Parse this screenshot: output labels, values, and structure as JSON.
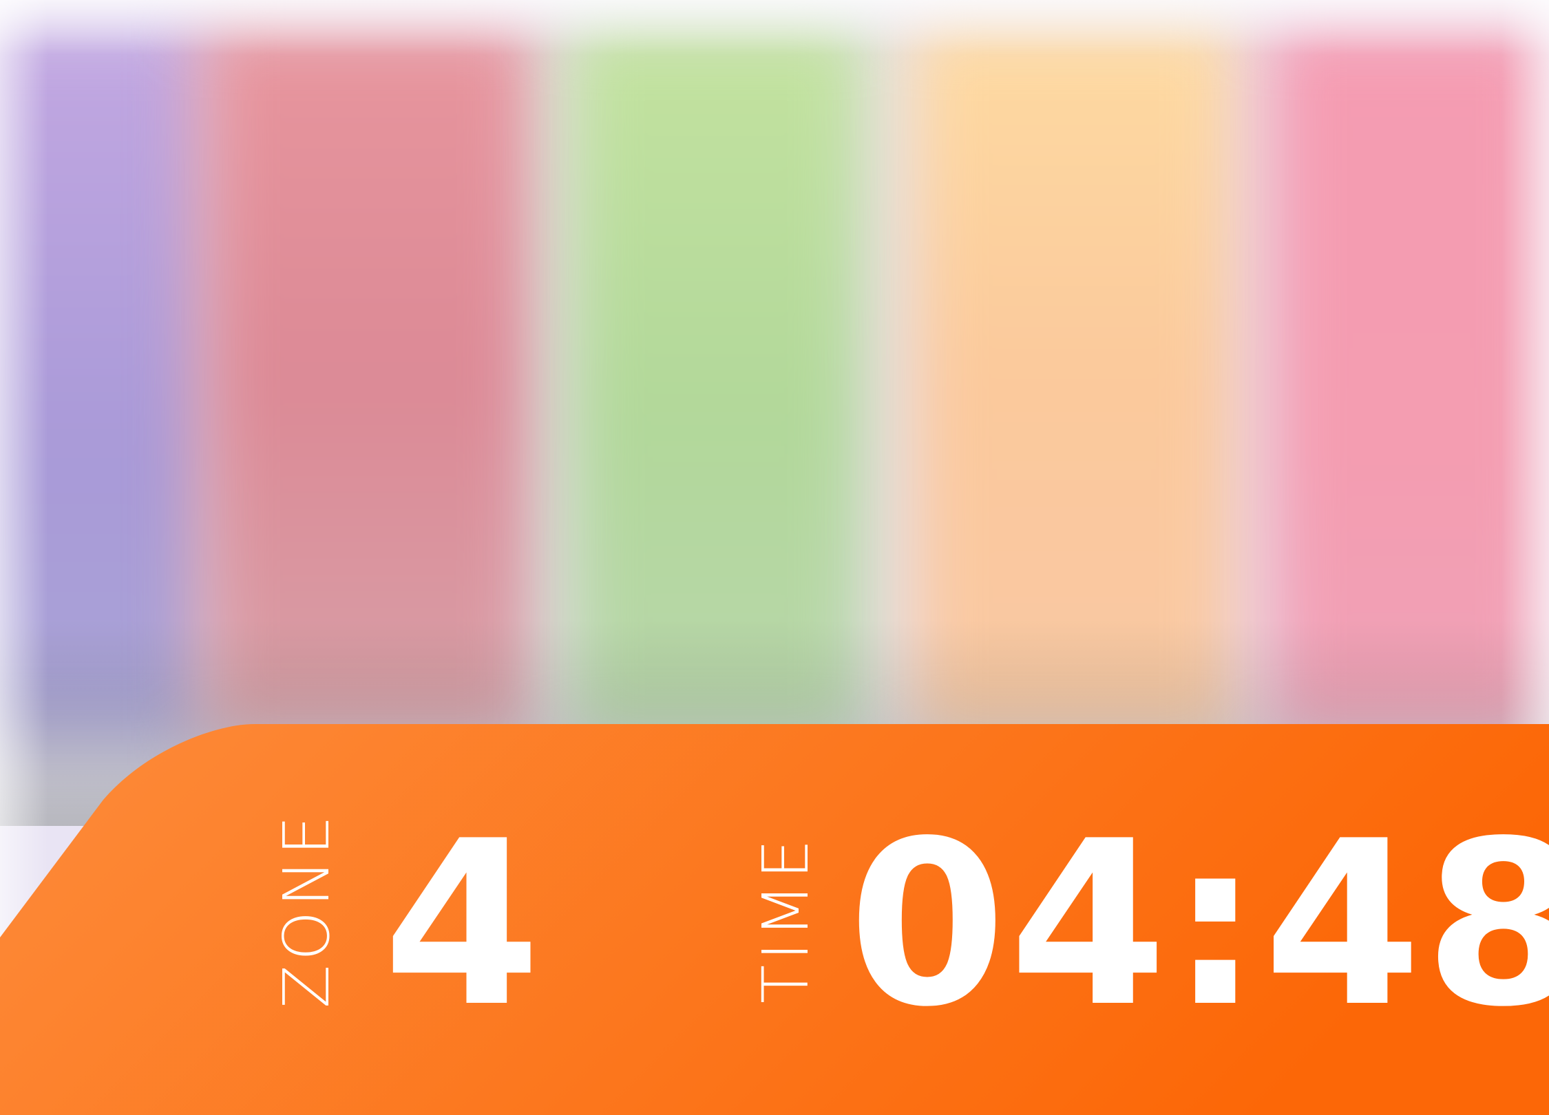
{
  "zone": {
    "label": "ZONE",
    "value": "4"
  },
  "timer": {
    "label": "TIME",
    "value": "04:48"
  },
  "colors": {
    "panel_start": "#fd8b3a",
    "panel_end": "#fc6707",
    "text": "#ffffff",
    "background_columns": [
      "#b0a0da",
      "#de8c98",
      "#b7db9c",
      "#fbcf9e",
      "#f49db1"
    ]
  }
}
